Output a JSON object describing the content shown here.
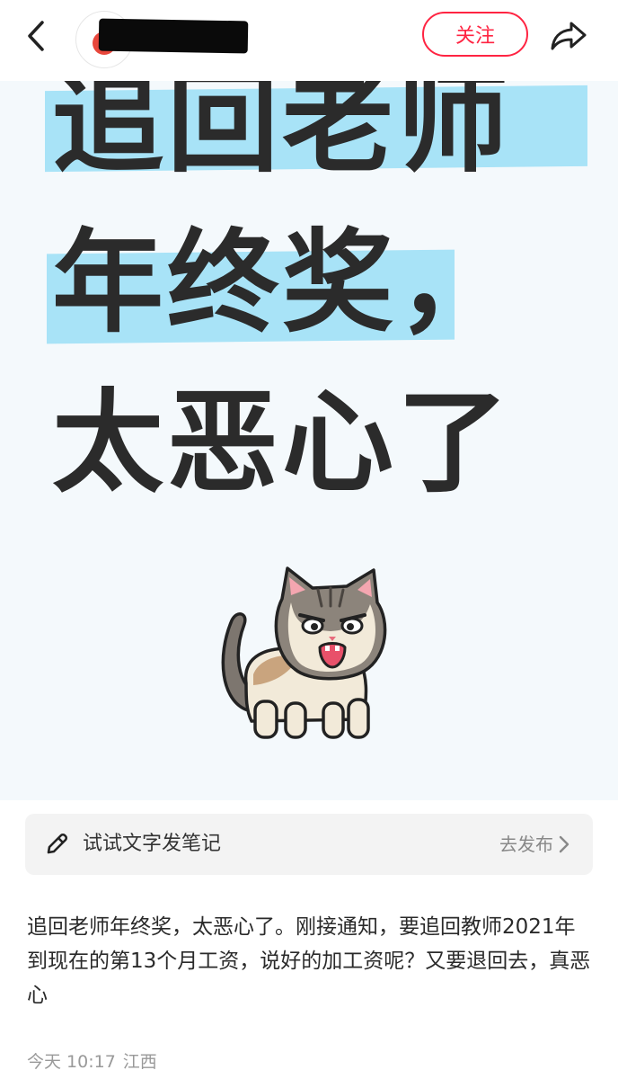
{
  "header": {
    "follow_label": "关注",
    "back_icon": "chevron-left-icon",
    "share_icon": "share-arrow-icon",
    "avatar_icon": "apple-icon",
    "accent_color": "#ff2442"
  },
  "image": {
    "line1": "追回老师",
    "line2": "年终奖，",
    "line3": "太恶心了",
    "highlight_color": "#a8e3f7",
    "illustration": "angry-cat-icon"
  },
  "note_bar": {
    "text": "试试文字发笔记",
    "action": "去发布",
    "icon": "pencil-icon"
  },
  "post": {
    "content": "追回老师年终奖，太恶心了。刚接通知，要追回教师2021年到现在的第13个月工资，说好的加工资呢？又要退回去，真恶心",
    "time": "今天 10:17",
    "location": "江西"
  }
}
